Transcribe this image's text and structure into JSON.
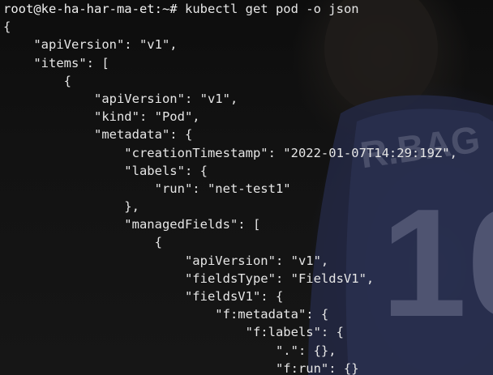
{
  "terminal": {
    "prompt": "root@ke-ha-har-ma-et:~#",
    "command": "kubectl get pod -o json",
    "output_lines": [
      "{",
      "    \"apiVersion\": \"v1\",",
      "    \"items\": [",
      "        {",
      "            \"apiVersion\": \"v1\",",
      "            \"kind\": \"Pod\",",
      "            \"metadata\": {",
      "                \"creationTimestamp\": \"2022-01-07T14:29:19Z\",",
      "                \"labels\": {",
      "                    \"run\": \"net-test1\"",
      "                },",
      "                \"managedFields\": [",
      "                    {",
      "                        \"apiVersion\": \"v1\",",
      "                        \"fieldsType\": \"FieldsV1\",",
      "                        \"fieldsV1\": {",
      "                            \"f:metadata\": {",
      "                                \"f:labels\": {",
      "                                    \".\": {},",
      "                                    \"f:run\": {}"
    ]
  },
  "background": {
    "jersey_text": "R.BAG",
    "jersey_number": "10"
  }
}
